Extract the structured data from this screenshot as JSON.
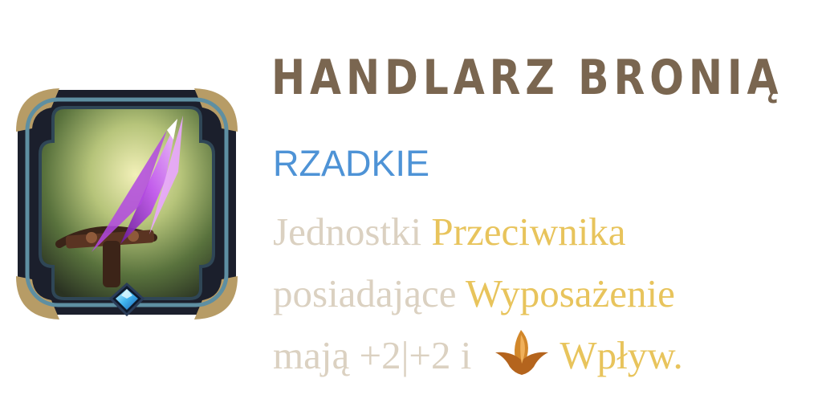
{
  "card": {
    "title": "HANDLARZ BRONIĄ",
    "rarity": "RZADKIE",
    "rarity_color": "#4e93d6",
    "title_color": "#7a6650",
    "keyword_color": "#e8c45c",
    "text_color": "#dbd1c1",
    "art": "crossbow-arrow-icon",
    "gem": "diamond-gem-icon",
    "description": {
      "line1_part1": "Jednostki ",
      "line1_keyword": "Przeciwnika",
      "line2_part1": "posiadające ",
      "line2_keyword": "Wyposażenie",
      "line3_part1": "mają +2|+2 i",
      "line3_icon": "influence-icon",
      "line3_keyword": "Wpływ."
    }
  }
}
